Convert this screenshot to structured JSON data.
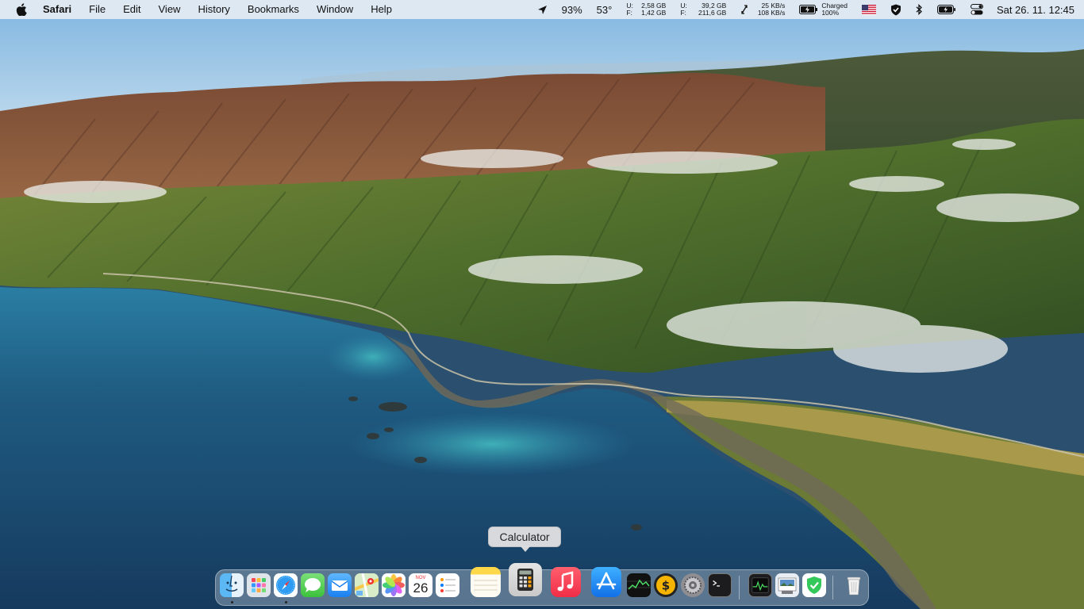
{
  "menubar": {
    "app_name": "Safari",
    "menus": [
      "File",
      "Edit",
      "View",
      "History",
      "Bookmarks",
      "Window",
      "Help"
    ],
    "status": {
      "location_icon": "location-arrow-icon",
      "cpu": "93%",
      "temperature": "53°",
      "memory": {
        "u_label": "U:",
        "u_value": "2,58 GB",
        "f_label": "F:",
        "f_value": "1,42 GB"
      },
      "disk": {
        "u_label": "U:",
        "u_value": "39,2 GB",
        "f_label": "F:",
        "f_value": "211,6 GB"
      },
      "network": {
        "up": "25 KB/s",
        "down": "108 KB/s"
      },
      "battery_text": {
        "line1": "Charged",
        "line2": "100%"
      },
      "flag_icon": "us-flag-icon",
      "clock": "Sat 26. 11.  12:45"
    }
  },
  "dock": {
    "tooltip": "Calculator",
    "calendar": {
      "month": "NOV",
      "day": "26"
    },
    "items": [
      {
        "name": "finder-icon",
        "running": true
      },
      {
        "name": "launchpad-icon",
        "running": false
      },
      {
        "name": "safari-icon",
        "running": true
      },
      {
        "name": "messages-icon",
        "running": false
      },
      {
        "name": "mail-icon",
        "running": false
      },
      {
        "name": "maps-icon",
        "running": false
      },
      {
        "name": "photos-icon",
        "running": false
      },
      {
        "name": "calendar-icon",
        "running": false
      },
      {
        "name": "reminders-icon",
        "running": false
      },
      {
        "name": "notes-icon",
        "running": false
      },
      {
        "name": "calculator-icon",
        "running": false
      },
      {
        "name": "music-icon",
        "running": false
      },
      {
        "name": "app-store-icon",
        "running": false
      },
      {
        "name": "stocks-icon",
        "running": false
      },
      {
        "name": "budget-app-icon",
        "running": false
      },
      {
        "name": "system-preferences-icon",
        "running": false
      },
      {
        "name": "terminal-icon",
        "running": false
      },
      {
        "name": "activity-monitor-icon",
        "running": false
      },
      {
        "name": "preview-icon",
        "running": false
      },
      {
        "name": "security-shield-icon",
        "running": false
      },
      {
        "name": "trash-icon",
        "running": false
      }
    ]
  },
  "colors": {
    "menubar_bg": "#ecf0f5",
    "sky": "#8fc3e6",
    "mountain_brown": "#8a5a3e",
    "mountain_green": "#4f6e2c",
    "ocean": "#1f4f72",
    "music_red": "#fa3c50",
    "app_store_blue": "#1f8bf0"
  }
}
